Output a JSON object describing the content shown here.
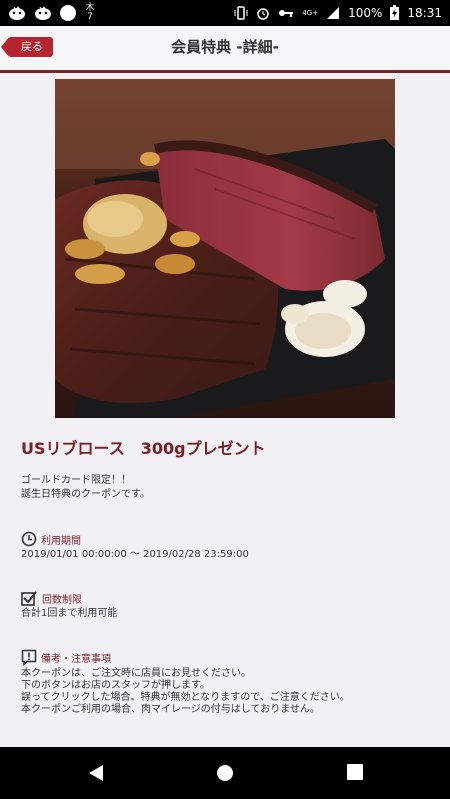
{
  "status_bar": {
    "day": "木\n7",
    "network": "4G+",
    "battery": "100%",
    "time": "18:31"
  },
  "header": {
    "back_label": "戻る",
    "title": "会員特典 -詳細-"
  },
  "coupon": {
    "title": "USリブロース　300gプレゼント",
    "description": [
      "ゴールドカード限定！！",
      "誕生日特典のクーポンです。"
    ]
  },
  "sections": {
    "period": {
      "label": "利用期間",
      "value": "2019/01/01 00:00:00 〜 2019/02/28 23:59:00",
      "icon": "clock-icon"
    },
    "limit": {
      "label": "回数制限",
      "value": "合計1回まで利用可能",
      "icon": "checkbox-icon"
    },
    "notes": {
      "label": "備考・注意事項",
      "lines": [
        "本クーポンは、ご注文時に店員にお見せください。",
        "下のボタンはお店のスタッフが押します。",
        "誤ってクリックした場合、特典が無効となりますので、ご注意ください。",
        "本クーポンご利用の場合、肉マイレージの付与はしておりません。"
      ],
      "icon": "notice-icon"
    }
  },
  "colors": {
    "accent": "#7a1f26",
    "back_button": "#b4252f",
    "background": "#f1f1f5"
  }
}
